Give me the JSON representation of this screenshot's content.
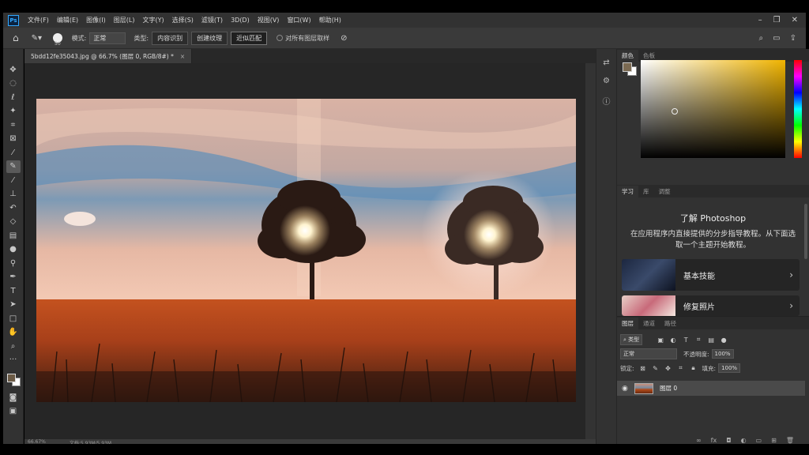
{
  "app": {
    "logo": "Ps"
  },
  "menu": [
    "文件(F)",
    "编辑(E)",
    "图像(I)",
    "图层(L)",
    "文字(Y)",
    "选择(S)",
    "滤镜(T)",
    "3D(D)",
    "视图(V)",
    "窗口(W)",
    "帮助(H)"
  ],
  "window_controls": {
    "minimize": "–",
    "restore": "❐",
    "close": "✕"
  },
  "options": {
    "brush_size": "50",
    "mode_label": "模式:",
    "mode_value": "正常",
    "type_label": "类型:",
    "type_buttons": [
      "内容识别",
      "创建纹理",
      "近似匹配"
    ],
    "sample_all_layers": "对所有图层取样"
  },
  "document": {
    "tab_title": "5bdd12fe35043.jpg @ 66.7% (图层 0, RGB/8#) *",
    "close": "×",
    "zoom": "66.67%",
    "doc_info": "文档:5.93M/5.93M"
  },
  "tools": [
    "move-icon",
    "marquee-icon",
    "lasso-icon",
    "magic-wand-icon",
    "crop-icon",
    "frame-icon",
    "eyedropper-icon",
    "healing-brush-icon",
    "brush-icon",
    "clone-stamp-icon",
    "history-brush-icon",
    "eraser-icon",
    "gradient-icon",
    "blur-icon",
    "dodge-icon",
    "pen-icon",
    "type-icon",
    "path-selection-icon",
    "rectangle-icon",
    "hand-icon",
    "zoom-icon",
    "more-tools-icon"
  ],
  "color_panel": {
    "tabs": [
      "颜色",
      "色板"
    ],
    "foreground": "#7b6a52",
    "background": "#ffffff",
    "hue": "#f0b400"
  },
  "learn_panel": {
    "tabs": [
      "学习",
      "库",
      "调整"
    ],
    "title": "了解 Photoshop",
    "description": "在应用程序内直接提供的分步指导教程。从下面选取一个主题开始教程。",
    "cards": [
      {
        "label": "基本技能"
      },
      {
        "label": "修复照片"
      }
    ]
  },
  "layers_panel": {
    "tabs": [
      "图层",
      "通道",
      "路径"
    ],
    "filter_label": "类型",
    "blend_mode": "正常",
    "opacity_label": "不透明度:",
    "opacity_value": "100%",
    "lock_label": "锁定:",
    "fill_label": "填充:",
    "fill_value": "100%",
    "layers": [
      {
        "name": "图层 0",
        "visible": true
      }
    ]
  }
}
